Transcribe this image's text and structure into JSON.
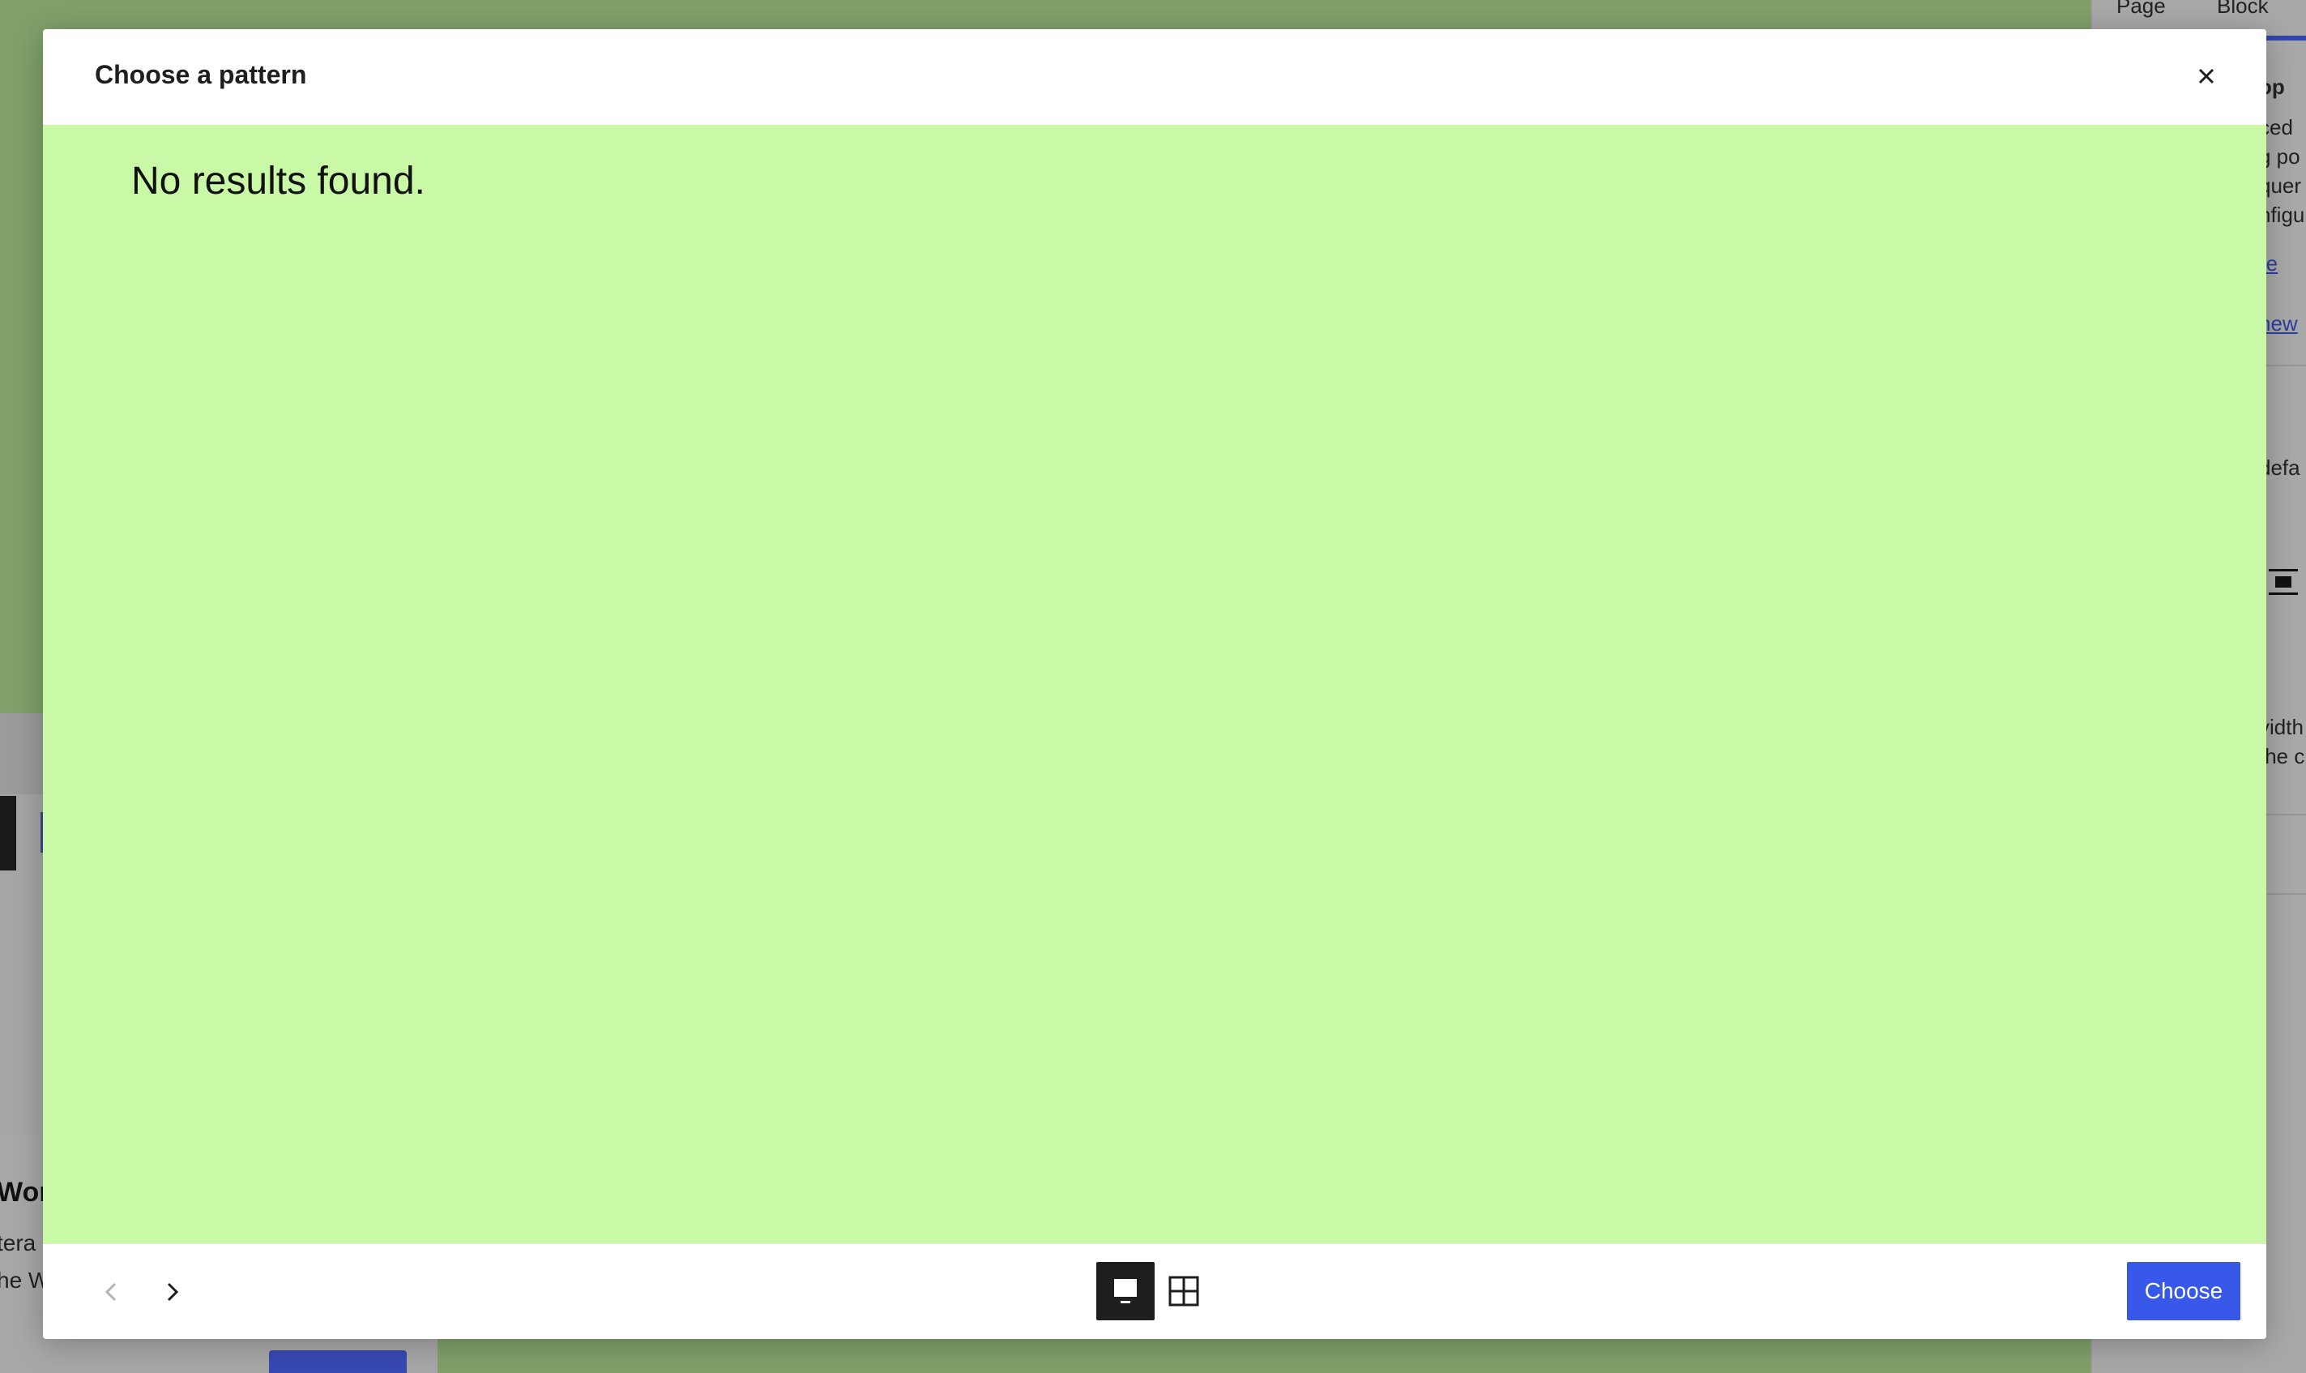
{
  "background": {
    "lower_left": {
      "heading": "Wor",
      "line1": "tera",
      "line2": "he W"
    },
    "sidebar": {
      "tabs": [
        "Page",
        "Block"
      ],
      "text_lines": [
        "op",
        "ced",
        "g po",
        "quer",
        "nfigu"
      ],
      "link_lines": [
        "re",
        "new"
      ],
      "setting_text": "defa",
      "width_lines": [
        "vidth",
        "the c"
      ]
    }
  },
  "modal": {
    "title": "Choose a pattern",
    "close_label": "Close",
    "empty_message": "No results found.",
    "footer": {
      "previous_label": "Previous pattern",
      "next_label": "Next pattern",
      "carousel_view_label": "Carousel view",
      "grid_view_label": "Grid view",
      "choose_label": "Choose"
    }
  },
  "colors": {
    "preview_background": "#c9f8a6",
    "primary_button": "#3858e9",
    "active_toggle": "#1e1e1e"
  }
}
